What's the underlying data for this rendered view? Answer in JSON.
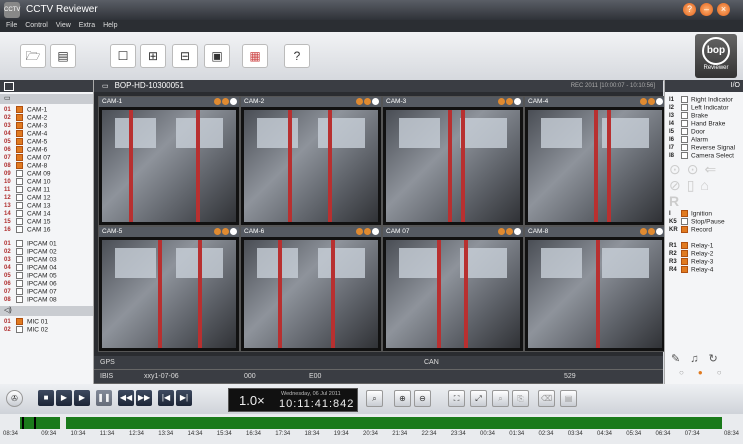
{
  "app": {
    "title": "CCTV Reviewer",
    "logo_text": "CCTV",
    "brand": "Reviewer",
    "brand_mark": "bop"
  },
  "menu": [
    "File",
    "Control",
    "View",
    "Extra",
    "Help"
  ],
  "toolbar": {
    "help_label": "?"
  },
  "device": {
    "id": "BOP-HD-10300051",
    "record_range": "REC 2011 [10:00:07 - 10:10:56]",
    "io_label": "I/O"
  },
  "cameras": [
    {
      "num": "01",
      "label": "CAM-1",
      "on": true
    },
    {
      "num": "02",
      "label": "CAM-2",
      "on": true
    },
    {
      "num": "03",
      "label": "CAM-3",
      "on": true
    },
    {
      "num": "04",
      "label": "CAM-4",
      "on": true
    },
    {
      "num": "05",
      "label": "CAM-5",
      "on": true
    },
    {
      "num": "06",
      "label": "CAM-6",
      "on": true
    },
    {
      "num": "07",
      "label": "CAM 07",
      "on": true
    },
    {
      "num": "08",
      "label": "CAM-8",
      "on": true
    },
    {
      "num": "09",
      "label": "CAM 09",
      "on": false
    },
    {
      "num": "10",
      "label": "CAM 10",
      "on": false
    },
    {
      "num": "11",
      "label": "CAM 11",
      "on": false
    },
    {
      "num": "12",
      "label": "CAM 12",
      "on": false
    },
    {
      "num": "13",
      "label": "CAM 13",
      "on": false
    },
    {
      "num": "14",
      "label": "CAM 14",
      "on": false
    },
    {
      "num": "15",
      "label": "CAM 15",
      "on": false
    },
    {
      "num": "16",
      "label": "CAM 16",
      "on": false
    }
  ],
  "ipcams": [
    {
      "num": "01",
      "label": "IPCAM 01"
    },
    {
      "num": "02",
      "label": "IPCAM 02"
    },
    {
      "num": "03",
      "label": "IPCAM 03"
    },
    {
      "num": "04",
      "label": "IPCAM 04"
    },
    {
      "num": "05",
      "label": "IPCAM 05"
    },
    {
      "num": "06",
      "label": "IPCAM 06"
    },
    {
      "num": "07",
      "label": "IPCAM 07"
    },
    {
      "num": "08",
      "label": "IPCAM 08"
    }
  ],
  "mics": [
    {
      "num": "01",
      "label": "MIC 01",
      "on": true
    },
    {
      "num": "02",
      "label": "MIC 02",
      "on": false
    }
  ],
  "tiles": [
    "CAM-1",
    "CAM-2",
    "CAM-3",
    "CAM-4",
    "CAM-5",
    "CAM-6",
    "CAM 07",
    "CAM-8"
  ],
  "info": {
    "gps": "GPS",
    "can": "CAN",
    "ibis": "IBIS",
    "v1": "xxy1-07-06",
    "v2": "000",
    "v3": "E00",
    "v4": "529"
  },
  "inputs": [
    {
      "num": "I1",
      "label": "Right Indicator"
    },
    {
      "num": "I2",
      "label": "Left Indicator"
    },
    {
      "num": "I3",
      "label": "Brake"
    },
    {
      "num": "I4",
      "label": "Hand Brake"
    },
    {
      "num": "I5",
      "label": "Door"
    },
    {
      "num": "I6",
      "label": "Alarm"
    },
    {
      "num": "I7",
      "label": "Reverse Signal"
    },
    {
      "num": "I8",
      "label": "Camera Select"
    }
  ],
  "keys": [
    {
      "num": "I",
      "label": "Ignition",
      "on": true
    },
    {
      "num": "K5",
      "label": "Stop/Pause",
      "on": false
    },
    {
      "num": "KR",
      "label": "Record",
      "on": true
    }
  ],
  "relays": [
    {
      "num": "R1",
      "label": "Relay-1"
    },
    {
      "num": "R2",
      "label": "Relay-2"
    },
    {
      "num": "R3",
      "label": "Relay-3"
    },
    {
      "num": "R4",
      "label": "Relay-4"
    }
  ],
  "playback": {
    "speed": "1.0×",
    "date": "Wednesday, 06 Jul 2011",
    "time": "10:11:41:842"
  },
  "timeline": {
    "start": "08:34",
    "end": "08:34",
    "ticks": [
      "09:34",
      "10:34",
      "11:34",
      "12:34",
      "13:34",
      "14:34",
      "15:34",
      "16:34",
      "17:34",
      "18:34",
      "19:34",
      "20:34",
      "21:34",
      "22:34",
      "23:34",
      "00:34",
      "01:34",
      "02:34",
      "03:34",
      "04:34",
      "05:34",
      "06:34",
      "07:34"
    ]
  }
}
